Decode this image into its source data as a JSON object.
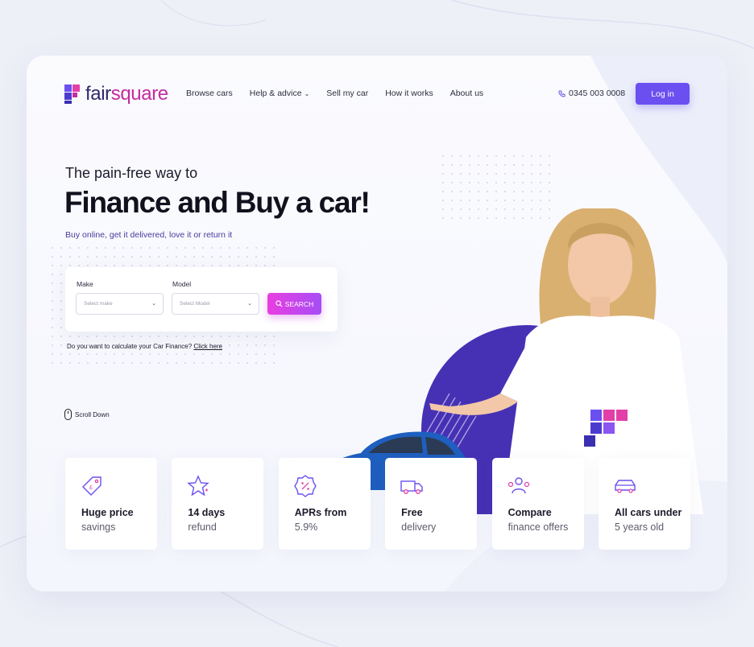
{
  "brand": {
    "name_part1": "fair",
    "name_part2": "square",
    "color_primary": "#6b4ff0",
    "color_accent": "#c52b9e"
  },
  "nav": {
    "items": [
      {
        "label": "Browse cars"
      },
      {
        "label": "Help & advice",
        "chevron": "⌄"
      },
      {
        "label": "Sell my car"
      },
      {
        "label": "How it works"
      },
      {
        "label": "About us"
      }
    ],
    "phone": "0345 003 0008",
    "login_label": "Log in"
  },
  "hero": {
    "tagline": "The pain-free way to",
    "headline": "Finance and Buy a car!",
    "subline": "Buy online, get it delivered, love it or return it"
  },
  "search": {
    "make_label": "Make",
    "make_placeholder": "Select make",
    "model_label": "Model",
    "model_placeholder": "Select Model",
    "button_label": "SEARCH"
  },
  "calc": {
    "question": "Do you want to calculate your Car Finance?",
    "link": "Click here"
  },
  "scroll_label": "Scroll Down",
  "features": [
    {
      "icon": "price-tag-icon",
      "line1": "Huge price",
      "line2": "savings"
    },
    {
      "icon": "star-icon",
      "line1": "14 days",
      "line2": "refund"
    },
    {
      "icon": "percent-badge-icon",
      "line1": "APRs from",
      "line2": "5.9%"
    },
    {
      "icon": "delivery-truck-icon",
      "line1": "Free",
      "line2": "delivery"
    },
    {
      "icon": "people-compare-icon",
      "line1": "Compare",
      "line2": "finance offers"
    },
    {
      "icon": "car-icon",
      "line1": "All cars under",
      "line2": "5 years old"
    }
  ]
}
